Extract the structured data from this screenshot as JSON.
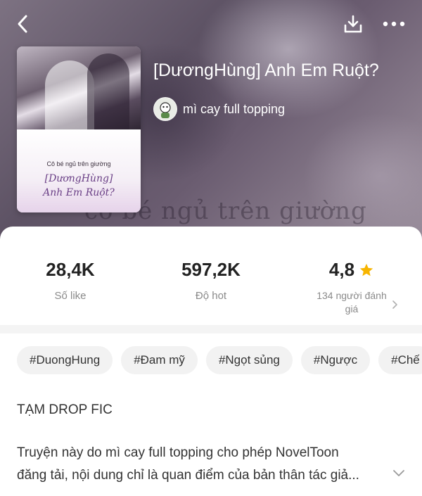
{
  "header": {
    "book_title": "[DươngHùng] Anh Em Ruột?",
    "author_name": "mì cay full topping",
    "background_ghost_text": "cô bé ngủ trên giường",
    "icons": {
      "back": "back-chevron-icon",
      "download": "download-icon",
      "more": "more-dots-icon"
    }
  },
  "cover": {
    "subtitle": "Cô bé ngủ trên giường",
    "title_line1": "[DươngHùng]",
    "title_line2": "Anh Em Ruột?"
  },
  "stats": [
    {
      "value": "28,4K",
      "label": "Số like"
    },
    {
      "value": "597,2K",
      "label": "Độ hot"
    },
    {
      "value": "4,8",
      "label": "134 người đánh giá",
      "icon": "star-icon"
    }
  ],
  "tags": [
    "#DuongHung",
    "#Đam mỹ",
    "#Ngọt sủng",
    "#Ngược",
    "#Chế"
  ],
  "description": {
    "status": "TẠM DROP FIC",
    "line1": "Truyện này do mì cay full topping cho phép NovelToon",
    "line2": "đăng tải, nội dung chỉ là quan điểm của bản thân tác giả..."
  },
  "colors": {
    "star": "#f7b500",
    "tag_bg": "#f2f2f2",
    "muted_text": "#8a8a8a"
  }
}
